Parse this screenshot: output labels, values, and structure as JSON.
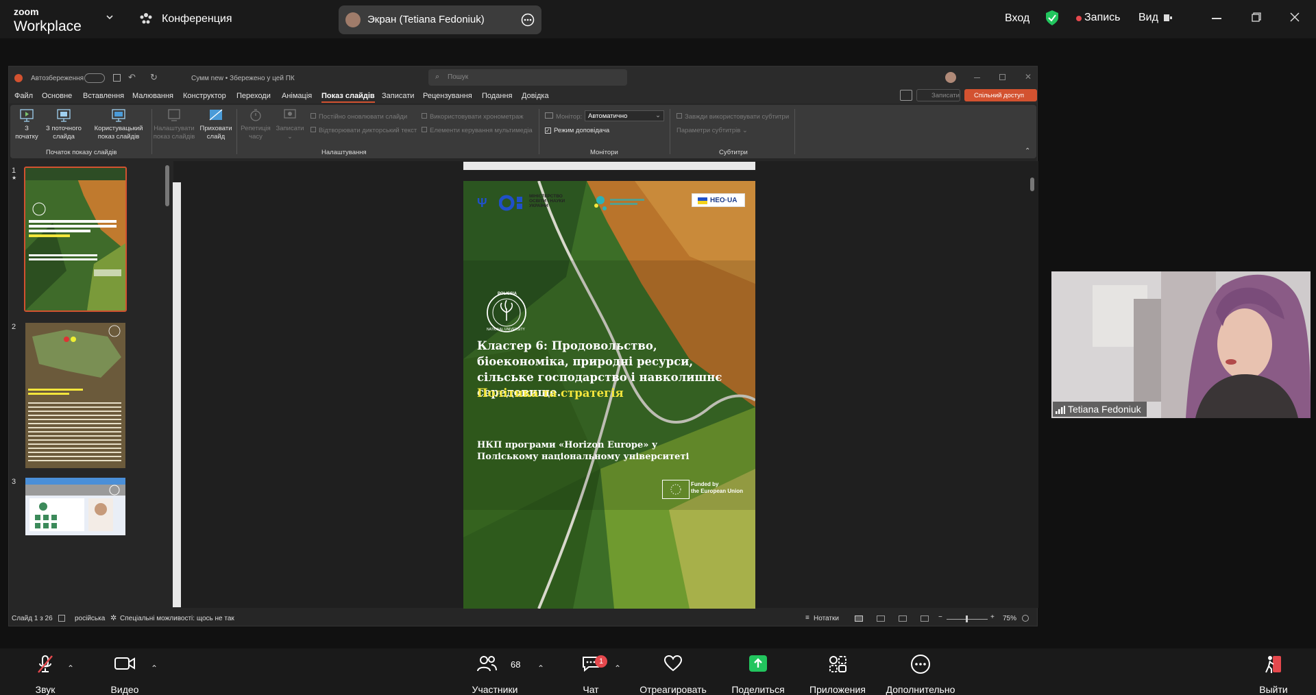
{
  "zoom": {
    "brand_top": "zoom",
    "brand_bottom": "Workplace",
    "meeting_label": "Конференция",
    "share_label": "Экран (Tetiana Fedoniuk)",
    "signin": "Вход",
    "record": "Запись",
    "view": "Вид"
  },
  "ppt": {
    "autosave": "Автозбереження",
    "doc_title": "Сумм new • Збережено у цей ПК",
    "search_placeholder": "Пошук",
    "menu": [
      "Файл",
      "Основне",
      "Вставлення",
      "Малювання",
      "Конструктор",
      "Переходи",
      "Анімація",
      "Показ слайдів",
      "Записати",
      "Рецензування",
      "Подання",
      "Довідка"
    ],
    "active_menu": "Показ слайдів",
    "record_btn": "Записати",
    "share_btn": "Спільний доступ",
    "ribbon": {
      "from_start_1": "З",
      "from_start_2": "початку",
      "from_current_1": "З поточного",
      "from_current_2": "слайда",
      "custom_1": "Користувацький",
      "custom_2": "показ слайдів",
      "group_start": "Початок показу слайдів",
      "setup_1": "Налаштувати",
      "setup_2": "показ слайдів",
      "hide_1": "Приховати",
      "hide_2": "слайд",
      "rehearse_1": "Репетиція",
      "rehearse_2": "часу",
      "record_1": "Записати",
      "cb_keep_updated": "Постійно оновлювати слайди",
      "cb_narration": "Відтворювати дикторський текст",
      "cb_timings": "Використовувати хронометраж",
      "cb_media": "Елементи керування мультимедіа",
      "group_setup": "Налаштування",
      "monitor_label": "Монітор:",
      "monitor_value": "Автоматично",
      "presenter_view": "Режим доповідача",
      "group_monitors": "Монітори",
      "cb_subtitles": "Завжди використовувати субтитри",
      "subtitle_settings": "Параметри субтитрів",
      "group_subtitles": "Субтитри"
    },
    "thumb_numbers": [
      "1",
      "2",
      "3"
    ],
    "status": {
      "slide_of": "Слайд 1 з 26",
      "language": "російська",
      "accessibility": "Спеціальні можливості: щось не так",
      "notes": "Нотатки",
      "zoom": "75%"
    }
  },
  "slide": {
    "ministry_1": "МІНІСТЕРСТВО",
    "ministry_2": "ОСВІТИ І НАУКИ",
    "ministry_3": "УКРАЇНИ",
    "heo": "HEO·UA",
    "title_white": "Кластер 6: Продовольство, біоекономіка, природні ресурси, сільське господарство і навколишнє середовище.",
    "title_yellow": "Політика та стратегія",
    "subtitle": "НКП програми «Horizon Europe» у Поліському національному університеті",
    "funded_1": "Funded by",
    "funded_2": "the European Union",
    "seal_top": "POLISSIA",
    "seal_bottom": "NATIONAL UNIVERSITY"
  },
  "webcam": {
    "name": "Tetiana Fedoniuk"
  },
  "toolbar": {
    "audio": "Звук",
    "video": "Видео",
    "participants": "Участники",
    "participants_count": "68",
    "chat": "Чат",
    "chat_badge": "1",
    "react": "Отреагировать",
    "share": "Поделиться",
    "apps": "Приложения",
    "more": "Дополнительно",
    "leave": "Выйти"
  },
  "colors": {
    "share_green": "#22c55e",
    "record_red": "#e5484d",
    "ppt_orange": "#d35230",
    "slide_yellow": "#f3e53c"
  }
}
